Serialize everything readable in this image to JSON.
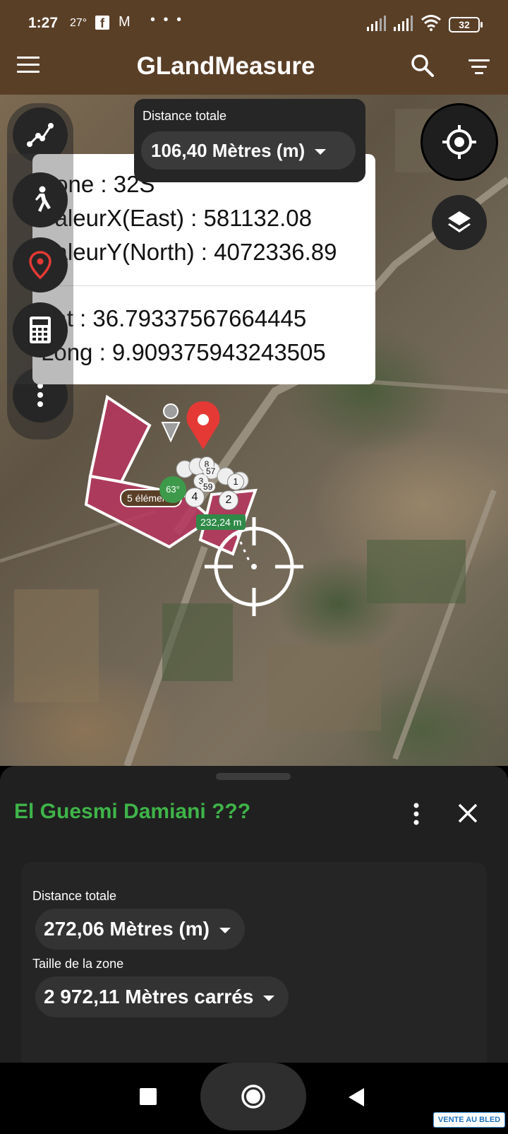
{
  "status_bar": {
    "time": "1:27",
    "temperature": "27°",
    "battery": "32",
    "overflow": "• • •",
    "icons": [
      "facebook-icon",
      "gmail-icon",
      "signal-icon",
      "wifi-icon",
      "battery-icon"
    ]
  },
  "app_bar": {
    "title": "GLandMeasure",
    "icons": [
      "menu-icon",
      "search-icon",
      "filter-icon"
    ]
  },
  "map_overlay": {
    "distance_label": "Distance totale",
    "distance_value": "106,40 Mètres (m)",
    "coords": {
      "zone": "Zone : 32S",
      "east": "ValeurX(East) : 581132.08",
      "north": "ValeurY(North) : 4072336.89",
      "lat": "Lat : 36.79337567664445",
      "long": "Long : 9.909375943243505"
    },
    "labels": {
      "elements": "5 éléments",
      "segment": "232,24 m",
      "angle": "63°",
      "point_4": "4",
      "point_2": "2",
      "point_1": "1",
      "point_3": "3",
      "point_57": "57",
      "point_59": "59",
      "point_8": "8"
    },
    "tools": [
      "measure-path-icon",
      "walk-icon",
      "location-pin-icon",
      "calculator-icon",
      "more-vert-icon"
    ],
    "right_buttons": [
      "my-location-icon",
      "layers-icon"
    ]
  },
  "bottom_sheet": {
    "title": "El Guesmi Damiani ???",
    "distance_label": "Distance totale",
    "distance_value": "272,06 Mètres (m)",
    "area_label": "Taille de la zone",
    "area_value": "2 972,11 Mètres carrés"
  },
  "watermark": "VENTE AU BLED",
  "colors": {
    "app_bar": "#5a3f27",
    "accent_green": "#3fb449",
    "polygon_fill": "#b8355f",
    "pin_red": "#e53935"
  }
}
